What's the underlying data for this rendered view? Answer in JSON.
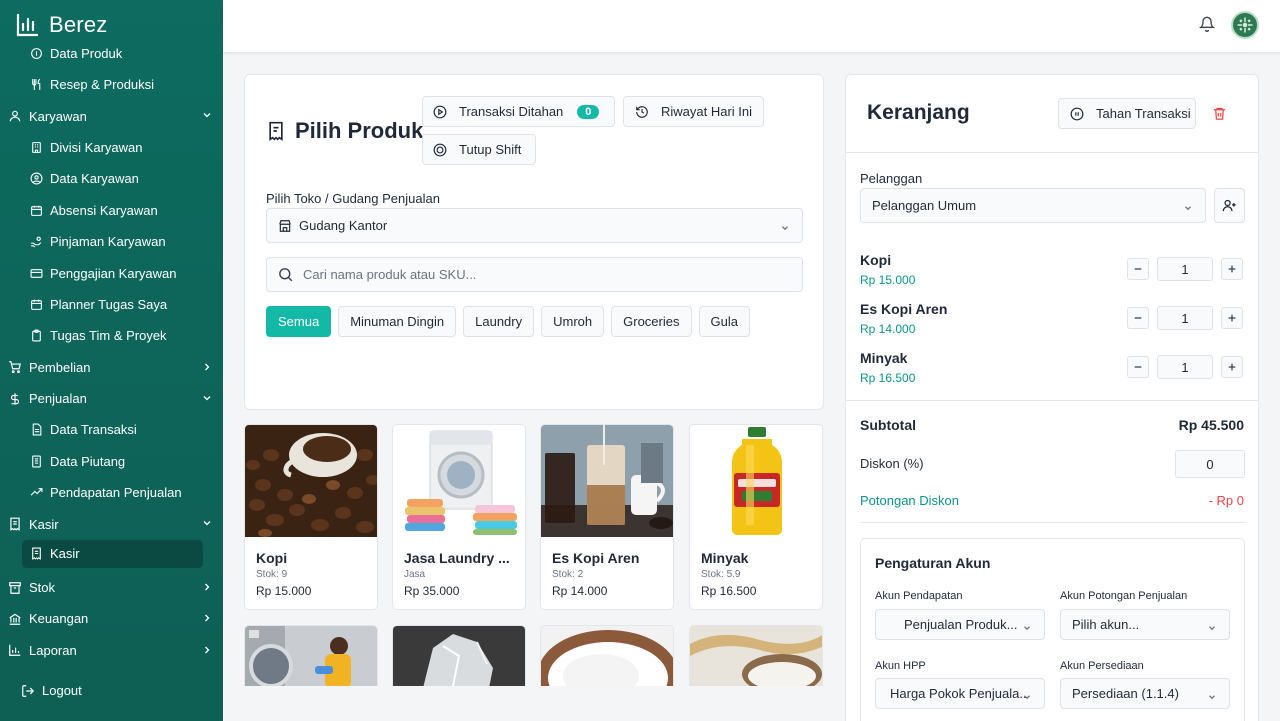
{
  "app": {
    "brand": "Berez"
  },
  "sidebar": {
    "items": [
      {
        "type": "sub",
        "label": "Data Produk",
        "icon": "box-icon"
      },
      {
        "type": "sub",
        "label": "Resep & Produksi",
        "icon": "utensils-icon"
      },
      {
        "type": "group",
        "label": "Karyawan",
        "icon": "user-icon",
        "expanded": true
      },
      {
        "type": "sub",
        "label": "Divisi Karyawan",
        "icon": "building-icon"
      },
      {
        "type": "sub",
        "label": "Data Karyawan",
        "icon": "user-circle-icon"
      },
      {
        "type": "sub",
        "label": "Absensi Karyawan",
        "icon": "calendar-icon"
      },
      {
        "type": "sub",
        "label": "Pinjaman Karyawan",
        "icon": "hand-coins-icon"
      },
      {
        "type": "sub",
        "label": "Penggajian Karyawan",
        "icon": "credit-card-icon"
      },
      {
        "type": "sub",
        "label": "Planner Tugas Saya",
        "icon": "calendar-icon"
      },
      {
        "type": "sub",
        "label": "Tugas Tim & Proyek",
        "icon": "clipboard-icon"
      },
      {
        "type": "group",
        "label": "Pembelian",
        "icon": "cart-icon",
        "expanded": false
      },
      {
        "type": "group",
        "label": "Penjualan",
        "icon": "dollar-icon",
        "expanded": true
      },
      {
        "type": "sub",
        "label": "Data Transaksi",
        "icon": "document-icon"
      },
      {
        "type": "sub",
        "label": "Data Piutang",
        "icon": "ledger-icon"
      },
      {
        "type": "sub",
        "label": "Pendapatan Penjualan",
        "icon": "trend-up-icon"
      },
      {
        "type": "group",
        "label": "Kasir",
        "icon": "receipt-icon",
        "expanded": true
      },
      {
        "type": "sub",
        "label": "Kasir",
        "icon": "receipt-icon",
        "active": true
      },
      {
        "type": "group",
        "label": "Stok",
        "icon": "archive-icon",
        "expanded": false
      },
      {
        "type": "group",
        "label": "Keuangan",
        "icon": "bank-icon",
        "expanded": false
      },
      {
        "type": "group",
        "label": "Laporan",
        "icon": "bar-chart-icon",
        "expanded": false
      }
    ],
    "logout": "Logout"
  },
  "products": {
    "title": "Pilih Produk",
    "held_label": "Transaksi Ditahan",
    "held_count": "0",
    "history_label": "Riwayat Hari Ini",
    "close_shift_label": "Tutup Shift",
    "store_label": "Pilih Toko / Gudang Penjualan",
    "store_value": "Gudang Kantor",
    "search_placeholder": "Cari nama produk atau SKU...",
    "categories": [
      "Semua",
      "Minuman Dingin",
      "Laundry",
      "Umroh",
      "Groceries",
      "Gula"
    ],
    "items": [
      {
        "name": "Kopi",
        "meta": "Stok: 9",
        "price": "Rp 15.000"
      },
      {
        "name": "Jasa Laundry ...",
        "meta": "Jasa",
        "price": "Rp 35.000"
      },
      {
        "name": "Es Kopi Aren",
        "meta": "Stok: 2",
        "price": "Rp 14.000"
      },
      {
        "name": "Minyak",
        "meta": "Stok: 5.9",
        "price": "Rp 16.500"
      }
    ]
  },
  "cart": {
    "title": "Keranjang",
    "hold_label": "Tahan Transaksi",
    "customer_label": "Pelanggan",
    "customer_value": "Pelanggan Umum",
    "items": [
      {
        "name": "Kopi",
        "price": "Rp 15.000",
        "qty": "1"
      },
      {
        "name": "Es Kopi Aren",
        "price": "Rp 14.000",
        "qty": "1"
      },
      {
        "name": "Minyak",
        "price": "Rp 16.500",
        "qty": "1"
      }
    ],
    "subtotal_label": "Subtotal",
    "subtotal_value": "Rp 45.500",
    "discount_label": "Diskon (%)",
    "discount_value": "0",
    "discount_cut_label": "Potongan Diskon",
    "discount_cut_value": "- Rp 0",
    "accounts": {
      "title": "Pengaturan Akun",
      "revenue_label": "Akun Pendapatan",
      "revenue_value": "Penjualan Produk...",
      "sales_cut_label": "Akun Potongan Penjualan",
      "sales_cut_value": "Pilih akun...",
      "hpp_label": "Akun HPP",
      "hpp_value": "Harga Pokok Penjuala...",
      "inventory_label": "Akun Persediaan",
      "inventory_value": "Persediaan (1.1.4)"
    }
  },
  "colors": {
    "sidebar": "#0d6b5f",
    "accent": "#14b8a6",
    "danger": "#ef4444",
    "price": "#0d9488"
  }
}
